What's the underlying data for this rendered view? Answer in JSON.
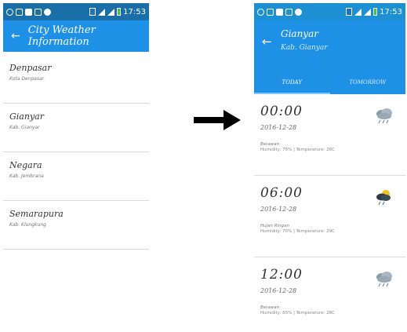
{
  "screen1": {
    "status_time": "17:53",
    "title": "City Weather Information",
    "cities": [
      {
        "name": "Denpasar",
        "sub": "Kota Denpasar"
      },
      {
        "name": "Gianyar",
        "sub": "Kab. Gianyar"
      },
      {
        "name": "Negara",
        "sub": "Kab. Jembrana"
      },
      {
        "name": "Semarapura",
        "sub": "Kab. Klungkung"
      }
    ]
  },
  "screen2": {
    "status_time": "17:53",
    "title": "Gianyar",
    "subtitle": "Kab. Gianyar",
    "tabs": [
      "TODAY",
      "TOMORROW"
    ],
    "forecasts": [
      {
        "time": "00:00",
        "date": "2016-12-28",
        "desc": "Berawan",
        "details": "Humidity: 75% | Temperature: 26C",
        "icon": "cloudy-rain-icon"
      },
      {
        "time": "06:00",
        "date": "2016-12-28",
        "desc": "Hujan Ringan",
        "details": "Humidity: 70% | Temperature: 29C",
        "icon": "sun-rain-icon"
      },
      {
        "time": "12:00",
        "date": "2016-12-28",
        "desc": "Berawan",
        "details": "Humidity: 85% | Temperature: 28C",
        "icon": "cloudy-rain-icon"
      }
    ]
  }
}
